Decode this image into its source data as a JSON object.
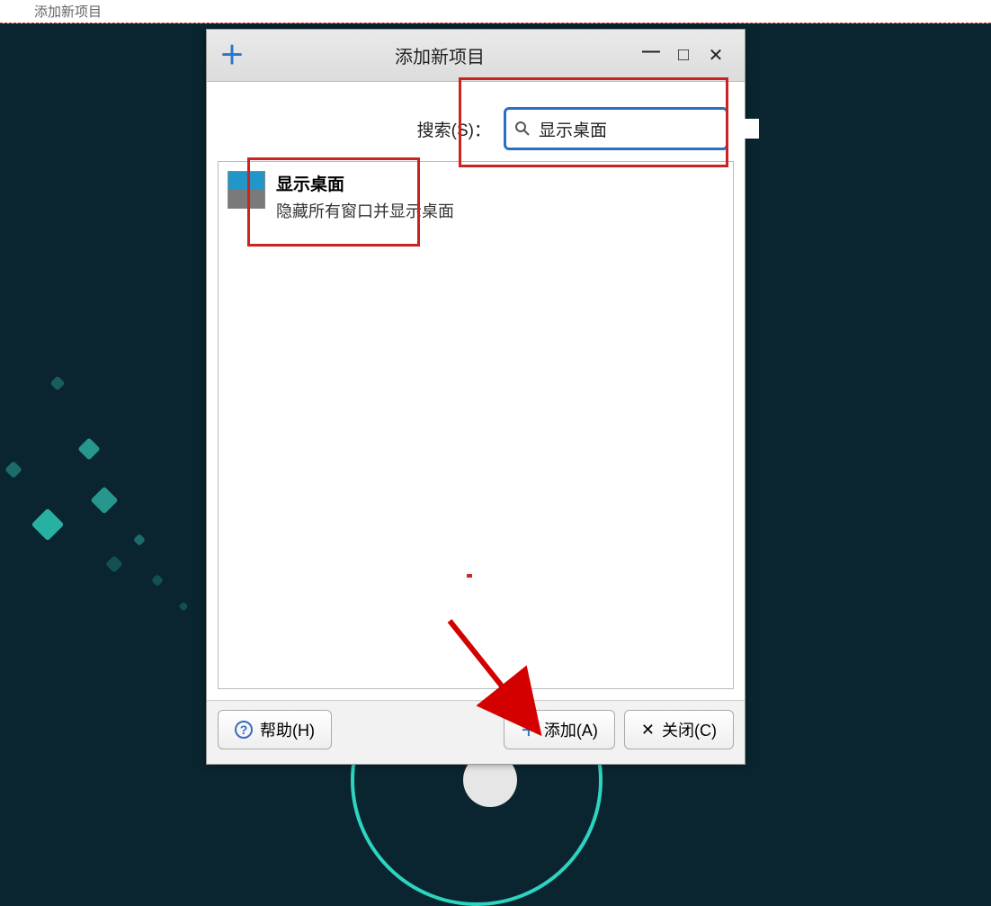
{
  "topbar": {
    "label": "添加新项目"
  },
  "dialog": {
    "title": "添加新项目",
    "search_label": "搜索(S)：",
    "search_value": "显示桌面",
    "result": {
      "title": "显示桌面",
      "desc": "隐藏所有窗口并显示桌面"
    },
    "buttons": {
      "help": "帮助(H)",
      "add": "添加(A)",
      "close": "关闭(C)"
    }
  },
  "annotations": {
    "highlight_color": "#c62828"
  }
}
